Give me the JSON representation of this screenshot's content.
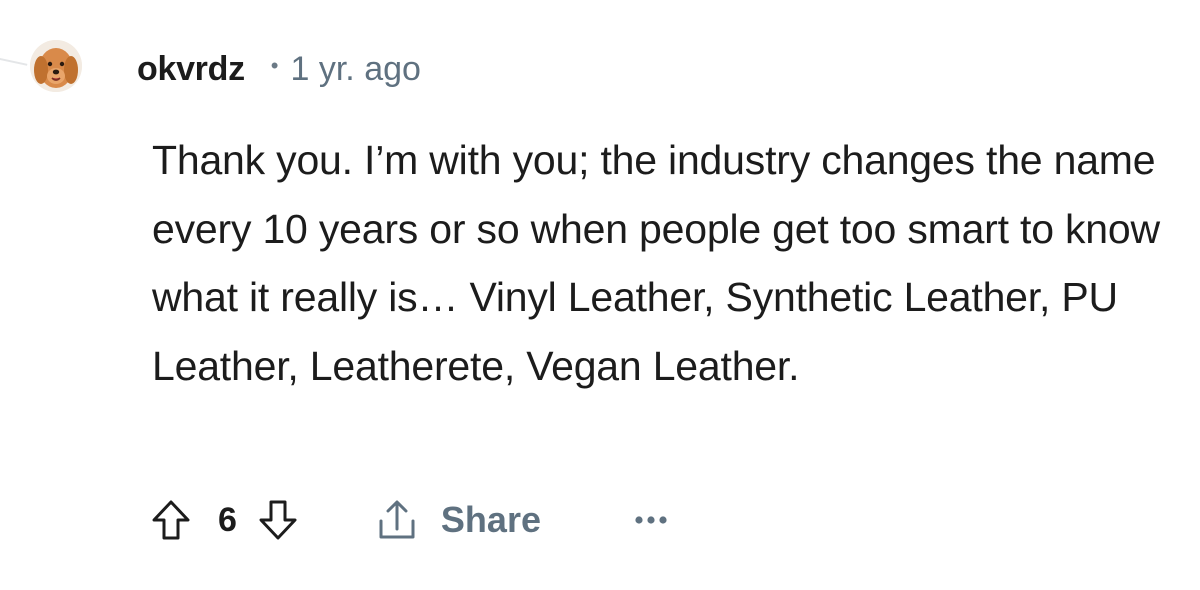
{
  "comment": {
    "username": "okvrdz",
    "separator": "•",
    "timestamp": "1 yr. ago",
    "body": "Thank you. I’m with you; the industry changes the name every 10 years or so when people get too smart to know what it really is… Vinyl Leather, Synthetic Leather, PU Leather, Leatherete, Vegan Leather.",
    "vote_count": "6",
    "share_label": "Share"
  },
  "icons": {
    "avatar": "dog-avatar-icon",
    "upvote": "upvote-arrow-icon",
    "downvote": "downvote-arrow-icon",
    "share": "share-icon",
    "more": "more-options-icon"
  },
  "colors": {
    "text_primary": "#1c1c1c",
    "text_secondary": "#5f7180",
    "background": "#ffffff"
  }
}
